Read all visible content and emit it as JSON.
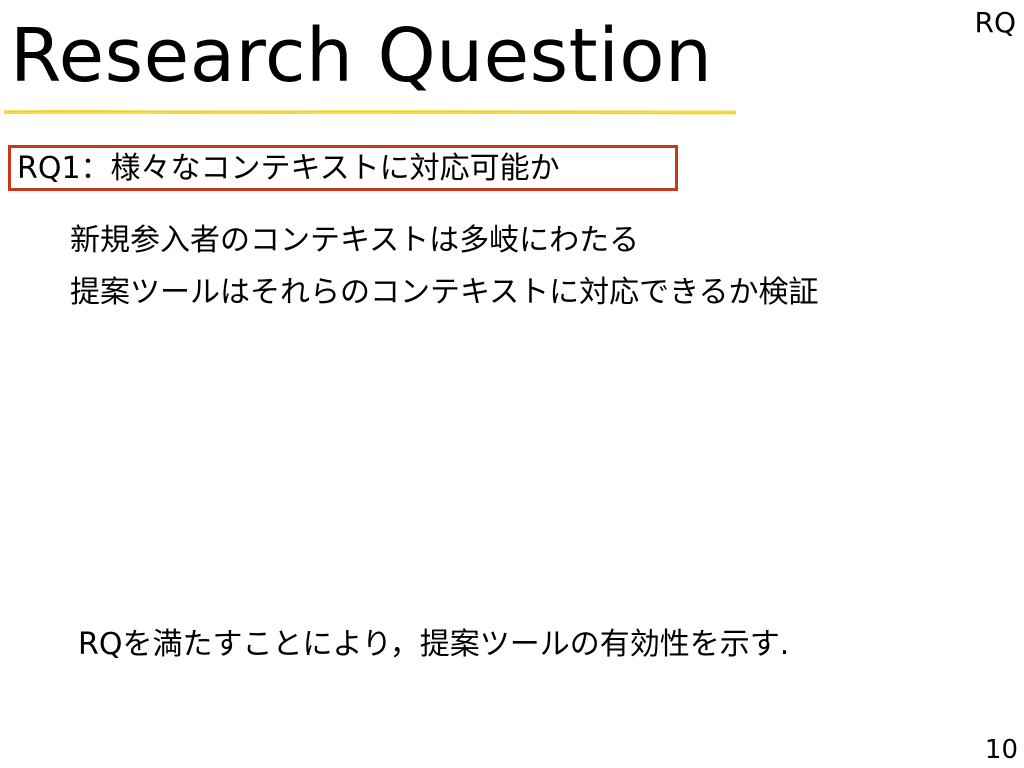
{
  "slide": {
    "title": "Research Question",
    "section_tag": "RQ",
    "rq1": "RQ1：様々なコンテキストに対応可能か",
    "bullets": [
      "新規参入者のコンテキストは多岐にわたる",
      "提案ツールはそれらのコンテキストに対応できるか検証"
    ],
    "conclusion": "RQを満たすことにより，提案ツールの有効性を示す.",
    "page_number": "10"
  },
  "colors": {
    "underline": "#f5d21e",
    "box_border": "#c8381f"
  }
}
